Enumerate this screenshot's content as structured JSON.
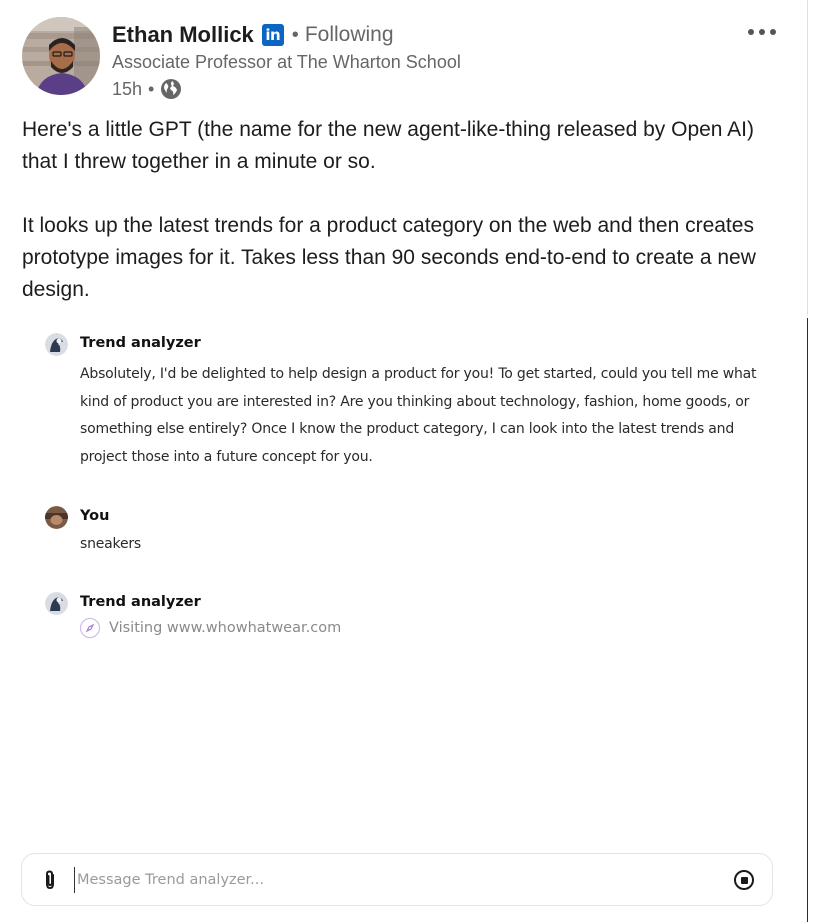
{
  "post": {
    "author": {
      "name": "Ethan Mollick",
      "badge": "in",
      "follow_status": "Following",
      "headline": "Associate Professor at The Wharton School"
    },
    "meta": {
      "time": "15h",
      "visibility_icon": "globe-icon"
    },
    "text": [
      "Here's a little GPT (the name for the new agent-like-thing released by Open AI) that I threw together in a minute or so.",
      "It looks up the latest trends for a product category on the web and then creates prototype images for it. Takes less than 90 seconds end-to-end to create a new design."
    ]
  },
  "chat": {
    "messages": [
      {
        "author": "Trend analyzer",
        "text": "Absolutely, I'd be delighted to help design a product for you! To get started, could you tell me what kind of product you are interested in? Are you thinking about technology, fashion, home goods, or something else entirely? Once I know the product category, I can look into the latest trends and project those into a future concept for you."
      },
      {
        "author": "You",
        "text": "sneakers"
      },
      {
        "author": "Trend analyzer",
        "status": "Visiting www.whowhatwear.com"
      }
    ],
    "composer": {
      "placeholder": "Message Trend analyzer..."
    }
  },
  "colors": {
    "linkedin_blue": "#0a66c2",
    "muted_text": "#666666",
    "status_purple": "#a87fd6"
  }
}
